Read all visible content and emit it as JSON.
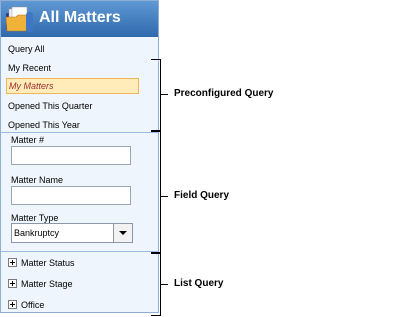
{
  "panel": {
    "title": "All Matters",
    "preconfigured": [
      "Query All",
      "My Recent",
      "My Matters",
      "Opened This Quarter",
      "Opened This Year"
    ],
    "selected_index": 2,
    "fields": {
      "matter_number_label": "Matter #",
      "matter_number_value": "",
      "matter_name_label": "Matter Name",
      "matter_name_value": "",
      "matter_type_label": "Matter Type",
      "matter_type_value": "Bankruptcy"
    },
    "list": [
      "Matter Status",
      "Matter Stage",
      "Office"
    ]
  },
  "annotations": {
    "preconfigured": "Preconfigured Query",
    "field": "Field Query",
    "list": "List Query"
  },
  "colors": {
    "header": "#2f69ad",
    "panel_bg": "#eef5fc",
    "selected_bg": "#ffecb8",
    "selected_text": "#9c2f2f"
  }
}
